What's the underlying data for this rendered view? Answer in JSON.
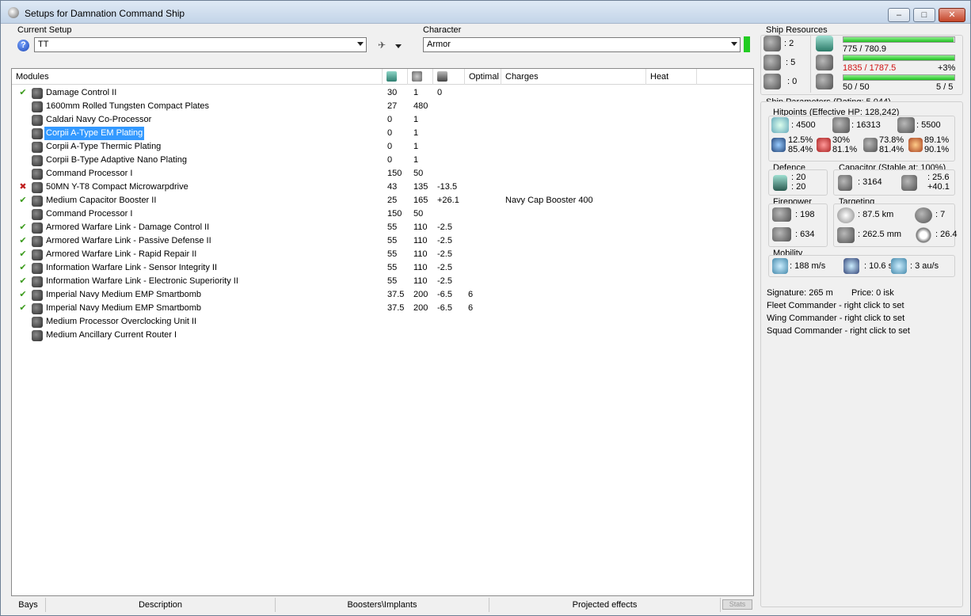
{
  "window": {
    "title": "Setups for Damnation Command Ship"
  },
  "setup": {
    "label": "Current Setup",
    "value": "TT"
  },
  "character": {
    "label": "Character",
    "value": "Armor"
  },
  "modules": {
    "headers": {
      "modules": "Modules",
      "optimal": "Optimal",
      "charges": "Charges",
      "heat": "Heat"
    },
    "rows": [
      {
        "state": "ok",
        "name": "Damage Control II",
        "c1": "30",
        "c2": "1",
        "c3": "0",
        "c4": "",
        "c5": ""
      },
      {
        "state": "",
        "name": "1600mm Rolled Tungsten Compact Plates",
        "c1": "27",
        "c2": "480",
        "c3": "",
        "c4": "",
        "c5": ""
      },
      {
        "state": "",
        "name": "Caldari Navy Co-Processor",
        "c1": "0",
        "c2": "1",
        "c3": "",
        "c4": "",
        "c5": ""
      },
      {
        "state": "",
        "name": "Corpii A-Type EM Plating",
        "c1": "0",
        "c2": "1",
        "c3": "",
        "c4": "",
        "c5": "",
        "selected": true
      },
      {
        "state": "",
        "name": "Corpii A-Type Thermic Plating",
        "c1": "0",
        "c2": "1",
        "c3": "",
        "c4": "",
        "c5": ""
      },
      {
        "state": "",
        "name": "Corpii B-Type Adaptive Nano Plating",
        "c1": "0",
        "c2": "1",
        "c3": "",
        "c4": "",
        "c5": ""
      },
      {
        "state": "",
        "name": "Command Processor I",
        "c1": "150",
        "c2": "50",
        "c3": "",
        "c4": "",
        "c5": ""
      },
      {
        "state": "off",
        "name": "50MN Y-T8 Compact Microwarpdrive",
        "c1": "43",
        "c2": "135",
        "c3": "-13.5",
        "c4": "",
        "c5": ""
      },
      {
        "state": "ok",
        "name": "Medium Capacitor Booster II",
        "c1": "25",
        "c2": "165",
        "c3": "+26.1",
        "c4": "",
        "c5": "Navy Cap Booster 400"
      },
      {
        "state": "",
        "name": "Command Processor I",
        "c1": "150",
        "c2": "50",
        "c3": "",
        "c4": "",
        "c5": ""
      },
      {
        "state": "ok",
        "name": "Armored Warfare Link - Damage Control II",
        "c1": "55",
        "c2": "110",
        "c3": "-2.5",
        "c4": "",
        "c5": ""
      },
      {
        "state": "ok",
        "name": "Armored Warfare Link - Passive Defense II",
        "c1": "55",
        "c2": "110",
        "c3": "-2.5",
        "c4": "",
        "c5": ""
      },
      {
        "state": "ok",
        "name": "Armored Warfare Link - Rapid Repair II",
        "c1": "55",
        "c2": "110",
        "c3": "-2.5",
        "c4": "",
        "c5": ""
      },
      {
        "state": "ok",
        "name": "Information Warfare Link - Sensor Integrity II",
        "c1": "55",
        "c2": "110",
        "c3": "-2.5",
        "c4": "",
        "c5": ""
      },
      {
        "state": "ok",
        "name": "Information Warfare Link - Electronic Superiority II",
        "c1": "55",
        "c2": "110",
        "c3": "-2.5",
        "c4": "",
        "c5": ""
      },
      {
        "state": "ok",
        "name": "Imperial Navy Medium EMP Smartbomb",
        "c1": "37.5",
        "c2": "200",
        "c3": "-6.5",
        "c4": "6",
        "c5": ""
      },
      {
        "state": "ok",
        "name": "Imperial Navy Medium EMP Smartbomb",
        "c1": "37.5",
        "c2": "200",
        "c3": "-6.5",
        "c4": "6",
        "c5": ""
      },
      {
        "state": "",
        "name": "Medium Processor Overclocking Unit II",
        "c1": "",
        "c2": "",
        "c3": "",
        "c4": "",
        "c5": ""
      },
      {
        "state": "",
        "name": "Medium Ancillary Current Router I",
        "c1": "",
        "c2": "",
        "c3": "",
        "c4": "",
        "c5": ""
      }
    ]
  },
  "statusbar": {
    "bays": "Bays",
    "description": "Description",
    "boosters": "Boosters\\Implants",
    "projected": "Projected effects",
    "stats": "Stats"
  },
  "resources": {
    "label": "Ship Resources",
    "hardpoints": {
      "turrets": ": 2",
      "launchers": ": 5",
      "drones": ": 0"
    },
    "cpu": {
      "text": "775 / 780.9",
      "fill": 0.992
    },
    "power": {
      "text": "1835 / 1787.5",
      "extra": "+3%",
      "fill": 1.0
    },
    "calibration": {
      "text": "50 / 50",
      "extra": "5 / 5",
      "fill": 1.0
    }
  },
  "params": {
    "label": "Ship Parameters (Rating: 5,044)",
    "hitpoints_label": "Hitpoints (Effective HP: 128,242)",
    "shield": ": 4500",
    "armor": ": 16313",
    "structure": ": 5500",
    "res1_a": "12.5%",
    "res1_b": "85.4%",
    "res2_a": "30%",
    "res2_b": "81.1%",
    "res3_a": "73.8%",
    "res3_b": "81.4%",
    "res4_a": "89.1%",
    "res4_b": "90.1%",
    "defence_label": "Defence",
    "def_a": ": 20",
    "def_b": ": 20",
    "capacitor_label": "Capacitor (Stable at: 100%)",
    "cap": ": 3164",
    "cap_a": ": 25.6",
    "cap_b": "+40.1",
    "firepower_label": "Firepower",
    "fp_a": ": 198",
    "fp_b": ": 634",
    "targeting_label": "Targeting",
    "tg_range": ": 87.5 km",
    "tg_count": ": 7",
    "tg_res": ": 262.5 mm",
    "tg_sensor": ": 26.4",
    "mobility_label": "Mobility",
    "mob_speed": ": 188 m/s",
    "mob_align": ": 10.6 s",
    "mob_warp": ": 3 au/s",
    "signature": "Signature: 265 m",
    "price": "Price: 0 isk",
    "fleet": "Fleet Commander - right click to set",
    "wing": "Wing Commander - right click to set",
    "squad": "Squad Commander - right click to set"
  }
}
